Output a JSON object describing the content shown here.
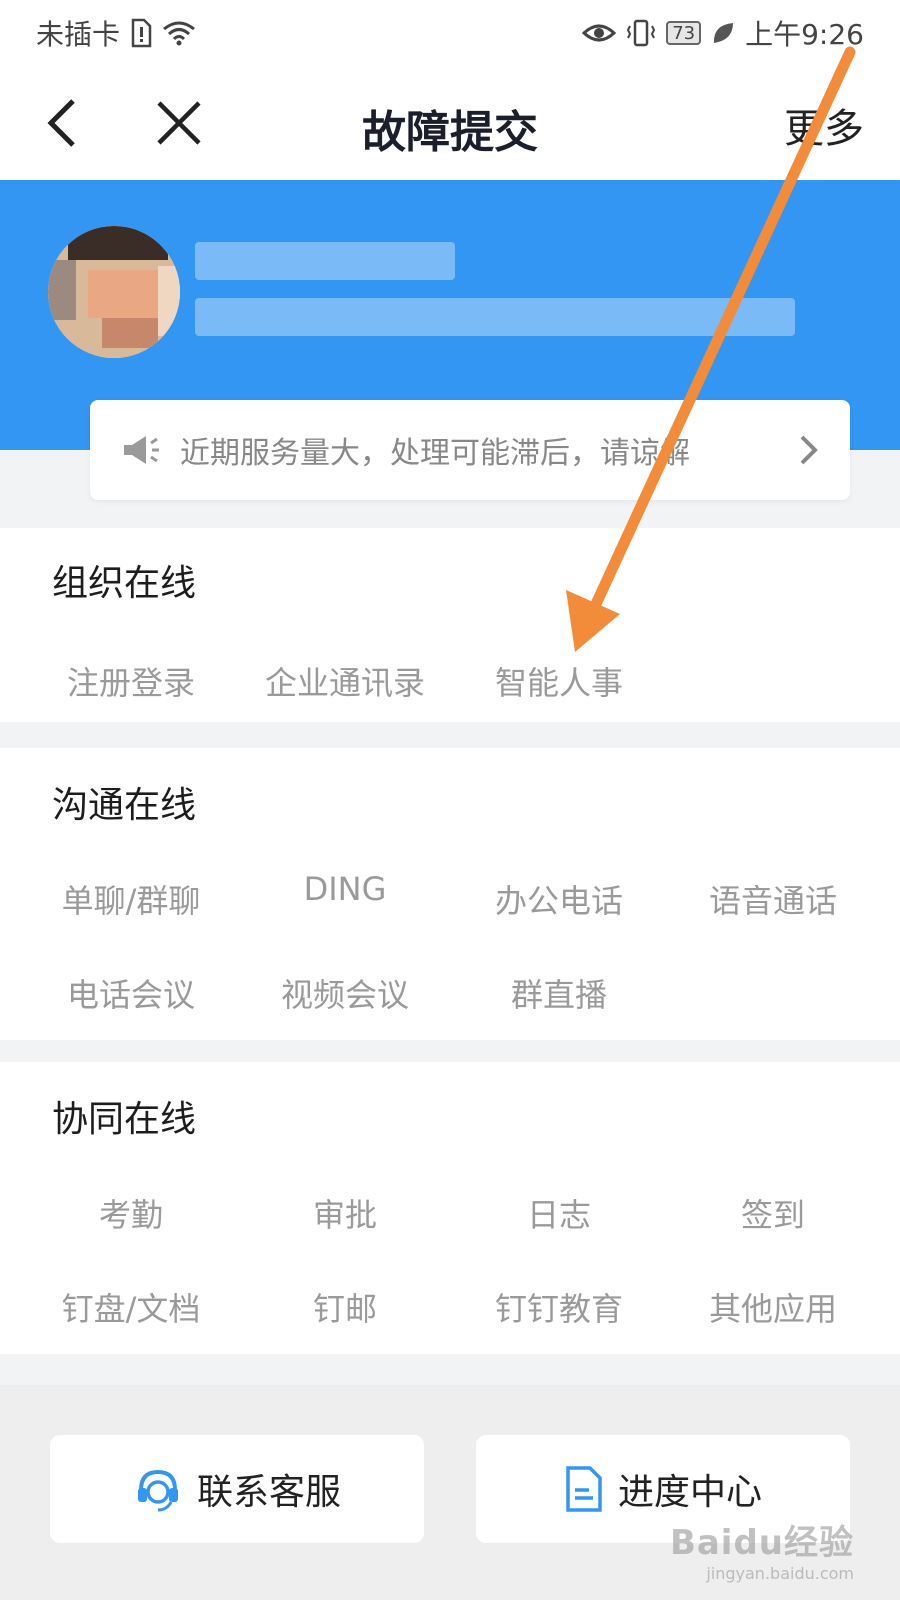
{
  "status_bar": {
    "carrier": "未插卡",
    "battery": "73",
    "time": "上午9:26",
    "icons": [
      "sim-alert-icon",
      "wifi-icon",
      "eye-icon",
      "vibrate-icon",
      "battery-icon",
      "leaf-icon"
    ]
  },
  "nav": {
    "title": "故障提交",
    "more_label": "更多",
    "back_icon": "chevron-left-icon",
    "close_icon": "close-icon"
  },
  "notice": {
    "text": "近期服务量大，处理可能滞后，请谅解",
    "icon": "megaphone-icon",
    "chevron": "chevron-right-icon"
  },
  "sections": [
    {
      "title": "组织在线",
      "items": [
        "注册登录",
        "企业通讯录",
        "智能人事"
      ]
    },
    {
      "title": "沟通在线",
      "items": [
        "单聊/群聊",
        "DING",
        "办公电话",
        "语音通话",
        "电话会议",
        "视频会议",
        "群直播"
      ]
    },
    {
      "title": "协同在线",
      "items": [
        "考勤",
        "审批",
        "日志",
        "签到",
        "钉盘/文档",
        "钉邮",
        "钉钉教育",
        "其他应用"
      ]
    }
  ],
  "bottom": {
    "contact_label": "联系客服",
    "progress_label": "进度中心"
  },
  "watermark": {
    "brand": "Baidu经验",
    "url": "jingyan.baidu.com"
  },
  "colors": {
    "brand_blue": "#3396f3",
    "annotation_arrow": "#f28c3b"
  }
}
